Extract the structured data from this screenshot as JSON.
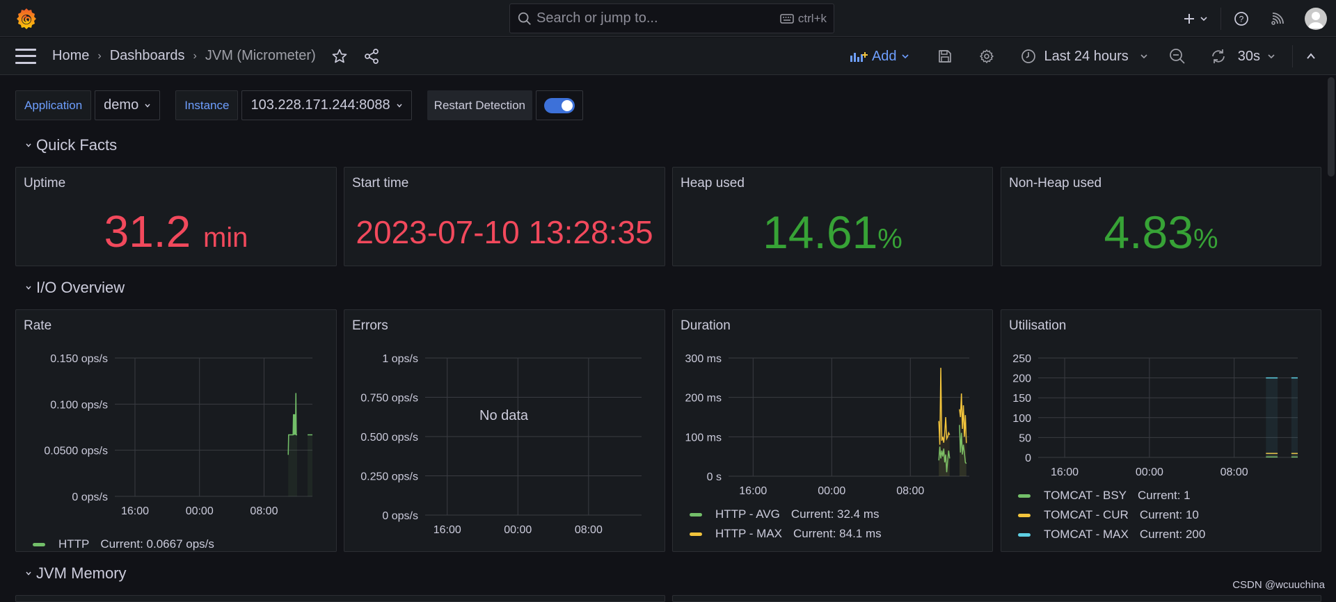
{
  "topbar": {
    "search_placeholder": "Search or jump to...",
    "search_shortcut": "ctrl+k",
    "icons": [
      "grafana-logo-icon",
      "search-icon",
      "keyboard-icon",
      "plus-icon",
      "help-icon",
      "rss-icon",
      "avatar"
    ]
  },
  "navbar": {
    "breadcrumbs": [
      "Home",
      "Dashboards",
      "JVM (Micrometer)"
    ],
    "add_label": "Add",
    "time_range": "Last 24 hours",
    "refresh_interval": "30s"
  },
  "variables": {
    "application_label": "Application",
    "application_value": "demo",
    "instance_label": "Instance",
    "instance_value": "103.228.171.244:8088",
    "restart_label": "Restart Detection",
    "restart_enabled": true
  },
  "rows": {
    "quick_facts": "Quick Facts",
    "io_overview": "I/O Overview",
    "jvm_memory": "JVM Memory"
  },
  "stats": [
    {
      "title": "Uptime",
      "value": "31.2",
      "unit": "min",
      "color": "#f2495c"
    },
    {
      "title": "Start time",
      "value": "2023-07-10 13:28:35",
      "unit": "",
      "color": "#f2495c"
    },
    {
      "title": "Heap used",
      "value": "14.61",
      "unit": "%",
      "color": "#37a336"
    },
    {
      "title": "Non-Heap used",
      "value": "4.83",
      "unit": "%",
      "color": "#37a336"
    }
  ],
  "colors": {
    "green": "#73bf69",
    "yellow": "#fade2a",
    "orange": "#f2c43c",
    "cyan": "#5ecfe3",
    "accent_blue": "#6e9fff",
    "red": "#f2495c"
  },
  "chart_data": [
    {
      "type": "line",
      "title": "Rate",
      "x_ticks": [
        "16:00",
        "00:00",
        "08:00"
      ],
      "y_ticks": [
        "0 ops/s",
        "0.0500 ops/s",
        "0.100 ops/s",
        "0.150 ops/s"
      ],
      "ylim": [
        0,
        0.15
      ],
      "x_range_hours": [
        -24,
        0
      ],
      "series": [
        {
          "name": "HTTP",
          "current": "Current: 0.0667 ops/s",
          "color": "#73bf69",
          "segments": [
            [
              [
                -3.0,
                0.045
              ],
              [
                -2.95,
                0.0667
              ],
              [
                -2.4,
                0.0667
              ],
              [
                -2.35,
                0.089
              ],
              [
                -2.3,
                0.0667
              ],
              [
                -2.25,
                0.089
              ],
              [
                -2.2,
                0.0667
              ],
              [
                -2.15,
                0.089
              ],
              [
                -2.1,
                0.0667
              ],
              [
                -2.05,
                0.112
              ],
              [
                -2.0,
                0.0667
              ],
              [
                -1.9,
                0.0667
              ]
            ],
            [
              [
                -0.6,
                0.0667
              ],
              [
                0,
                0.0667
              ]
            ]
          ]
        }
      ]
    },
    {
      "type": "line",
      "title": "Errors",
      "x_ticks": [
        "16:00",
        "00:00",
        "08:00"
      ],
      "y_ticks": [
        "0 ops/s",
        "0.250 ops/s",
        "0.500 ops/s",
        "0.750 ops/s",
        "1 ops/s"
      ],
      "ylim": [
        0,
        1
      ],
      "series": [],
      "no_data_text": "No data"
    },
    {
      "type": "line",
      "title": "Duration",
      "x_ticks": [
        "16:00",
        "00:00",
        "08:00"
      ],
      "y_ticks": [
        "0 s",
        "100 ms",
        "200 ms",
        "300 ms"
      ],
      "ylim": [
        0,
        300
      ],
      "series": [
        {
          "name": "HTTP - AVG",
          "current": "Current: 32.4 ms",
          "color": "#73bf69",
          "segments": [
            [
              [
                -3.1,
                40
              ],
              [
                -3.0,
                75
              ],
              [
                -2.9,
                45
              ],
              [
                -2.8,
                65
              ],
              [
                -2.7,
                50
              ],
              [
                -2.6,
                70
              ],
              [
                -2.5,
                35
              ],
              [
                -2.4,
                55
              ],
              [
                -2.3,
                10
              ],
              [
                -2.2,
                40
              ],
              [
                -2.1,
                65
              ],
              [
                -2.0,
                45
              ]
            ],
            [
              [
                -1.0,
                130
              ],
              [
                -0.9,
                60
              ],
              [
                -0.8,
                110
              ],
              [
                -0.7,
                55
              ],
              [
                -0.6,
                80
              ],
              [
                -0.5,
                60
              ],
              [
                -0.4,
                35
              ],
              [
                -0.3,
                32
              ]
            ]
          ]
        },
        {
          "name": "HTTP - MAX",
          "current": "Current: 84.1 ms",
          "color": "#f2c43c",
          "segments": [
            [
              [
                -3.1,
                140
              ],
              [
                -3.0,
                80
              ],
              [
                -2.9,
                275
              ],
              [
                -2.8,
                90
              ],
              [
                -2.7,
                100
              ],
              [
                -2.6,
                85
              ],
              [
                -2.5,
                110
              ],
              [
                -2.4,
                150
              ],
              [
                -2.3,
                95
              ],
              [
                -2.2,
                100
              ],
              [
                -2.1,
                110
              ],
              [
                -2.0,
                105
              ]
            ],
            [
              [
                -1.0,
                170
              ],
              [
                -0.9,
                150
              ],
              [
                -0.8,
                210
              ],
              [
                -0.7,
                120
              ],
              [
                -0.6,
                180
              ],
              [
                -0.5,
                100
              ],
              [
                -0.4,
                155
              ],
              [
                -0.3,
                84
              ]
            ]
          ]
        }
      ]
    },
    {
      "type": "line",
      "title": "Utilisation",
      "x_ticks": [
        "16:00",
        "00:00",
        "08:00"
      ],
      "y_ticks": [
        "0",
        "50",
        "100",
        "150",
        "200",
        "250"
      ],
      "ylim": [
        0,
        250
      ],
      "series": [
        {
          "name": "TOMCAT - BSY",
          "current": "Current: 1",
          "color": "#73bf69",
          "segments": [
            [
              [
                -3.0,
                1
              ],
              [
                -1.9,
                1
              ]
            ],
            [
              [
                -0.6,
                1
              ],
              [
                0,
                1
              ]
            ]
          ]
        },
        {
          "name": "TOMCAT - CUR",
          "current": "Current: 10",
          "color": "#f2c43c",
          "segments": [
            [
              [
                -3.0,
                10
              ],
              [
                -1.9,
                10
              ]
            ],
            [
              [
                -0.6,
                10
              ],
              [
                0,
                10
              ]
            ]
          ]
        },
        {
          "name": "TOMCAT - MAX",
          "current": "Current: 200",
          "color": "#5ecfe3",
          "segments": [
            [
              [
                -3.0,
                200
              ],
              [
                -1.9,
                200
              ]
            ],
            [
              [
                -0.6,
                200
              ],
              [
                0,
                200
              ]
            ]
          ]
        }
      ]
    }
  ],
  "watermark": "CSDN @wcuuchina"
}
